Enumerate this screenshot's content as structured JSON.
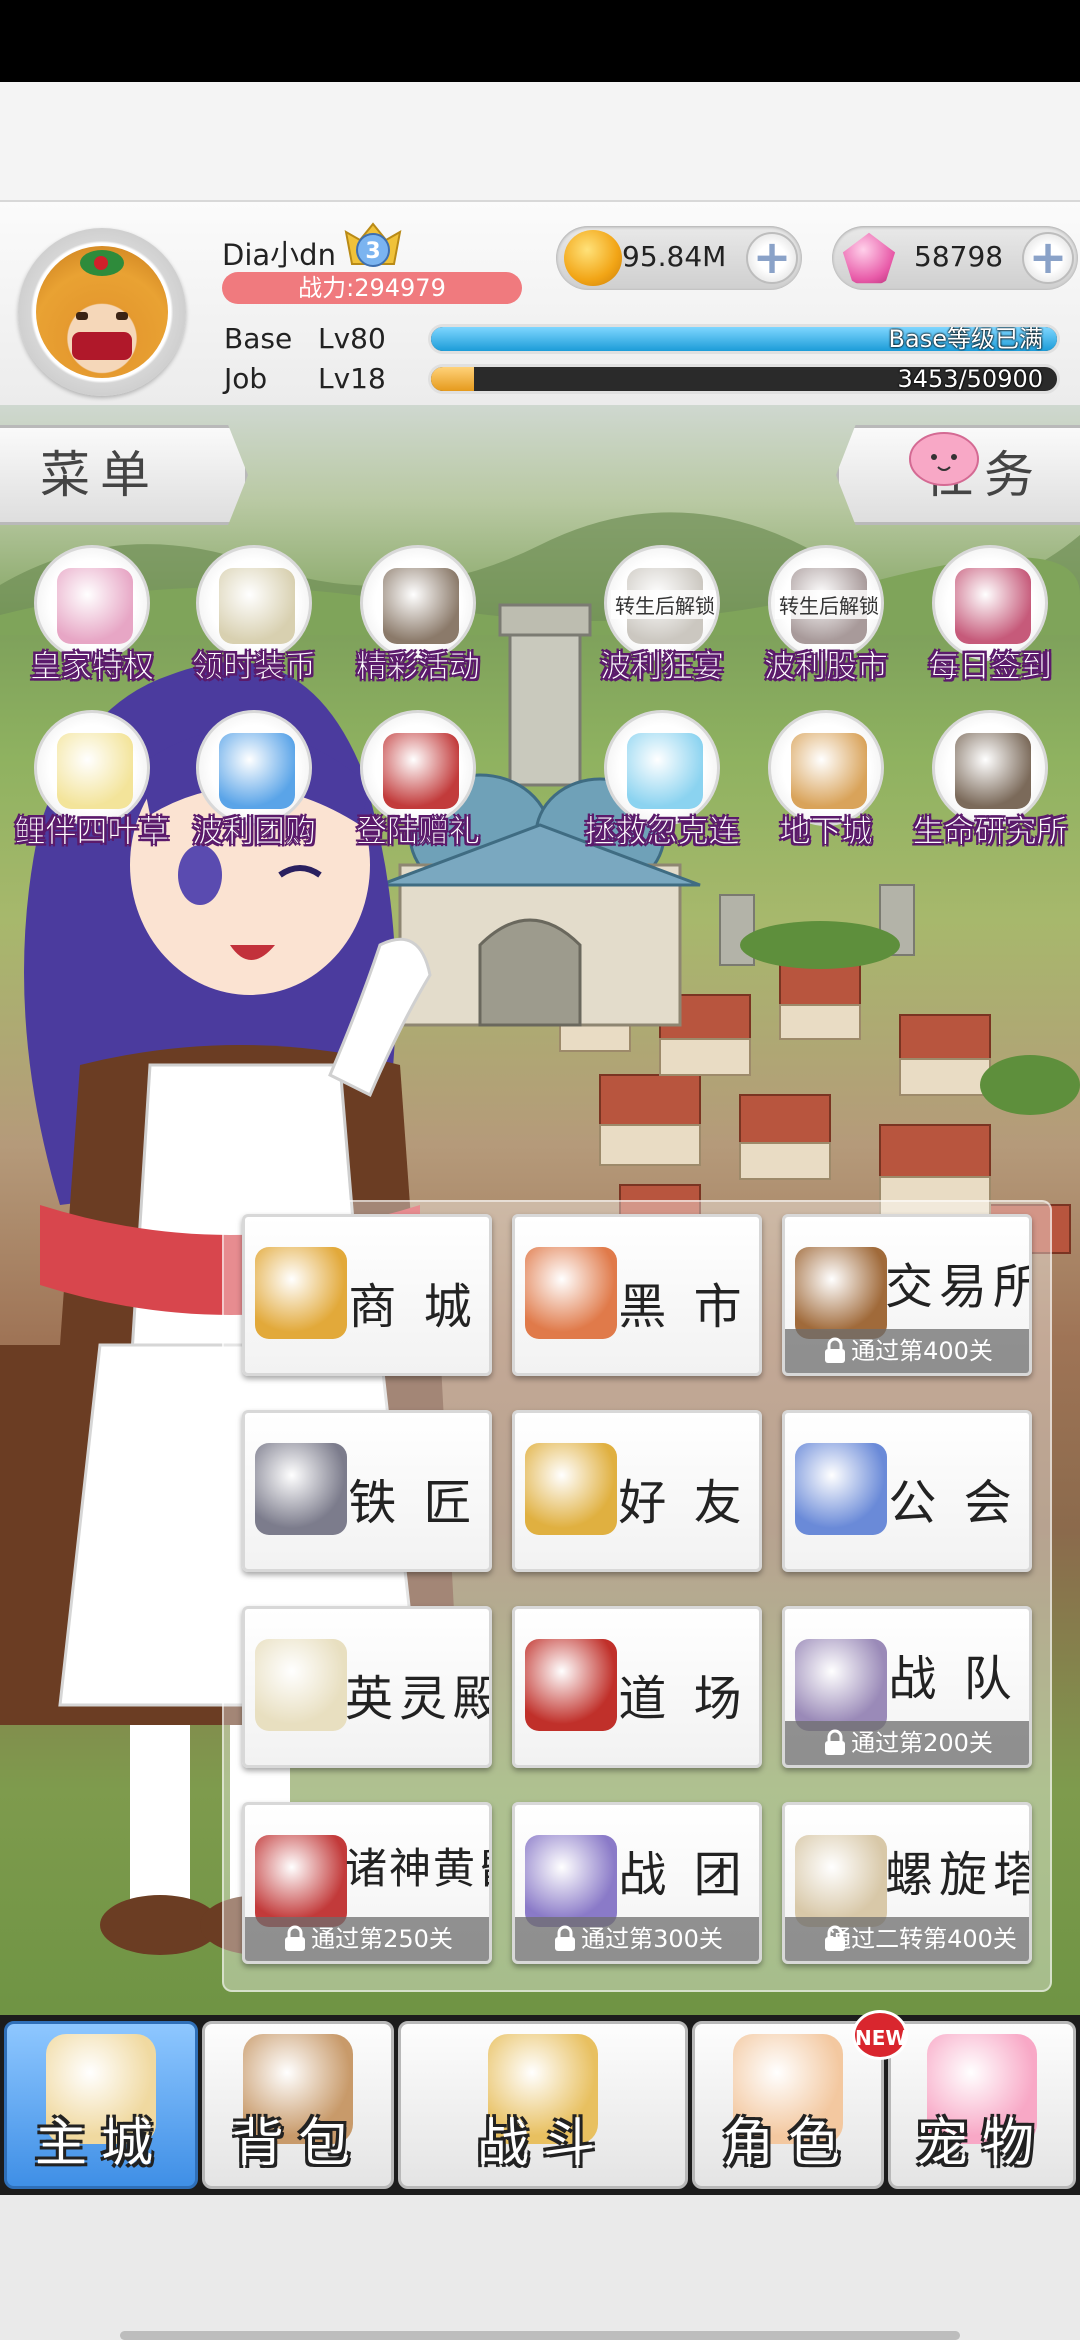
{
  "player": {
    "name": "Dia小dn",
    "rank_badge": "3",
    "combat_power": "战力:294979"
  },
  "currency": {
    "gold": "95.84M",
    "gems": "58798",
    "plus": "+"
  },
  "levels": {
    "base_label": "Base",
    "base_level": "Lv80",
    "base_bar_text": "Base等级已满",
    "base_progress": 1.0,
    "job_label": "Job",
    "job_level": "Lv18",
    "job_bar_text": "3453/50900",
    "job_progress": 0.068
  },
  "tabs": {
    "menu": "菜单",
    "tasks": "任务"
  },
  "features_row1": [
    {
      "label": "皇家特权",
      "icon": "royal-privilege-icon",
      "note": ""
    },
    {
      "label": "领时装币",
      "icon": "costume-coin-icon",
      "note": ""
    },
    {
      "label": "精彩活动",
      "icon": "events-icon",
      "note": ""
    },
    {
      "label": "波利狂宴",
      "icon": "poring-feast-icon",
      "note": "转生后解锁"
    },
    {
      "label": "波利股市",
      "icon": "poring-stock-icon",
      "note": "转生后解锁"
    },
    {
      "label": "每日签到",
      "icon": "daily-checkin-icon",
      "note": ""
    }
  ],
  "features_row2": [
    {
      "label": "鲤伴四叶草",
      "icon": "clover-icon",
      "note": ""
    },
    {
      "label": "波利团购",
      "icon": "group-buy-icon",
      "note": ""
    },
    {
      "label": "登陆赠礼",
      "icon": "login-gift-icon",
      "note": ""
    },
    {
      "label": "拯救忽克连",
      "icon": "rescue-icon",
      "note": ""
    },
    {
      "label": "地下城",
      "icon": "dungeon-icon",
      "note": ""
    },
    {
      "label": "生命研究所",
      "icon": "life-lab-icon",
      "note": ""
    }
  ],
  "grid": [
    {
      "name": "商 城",
      "icon": "treasure-chest-icon",
      "lock": ""
    },
    {
      "name": "黑 市",
      "icon": "money-bag-icon",
      "lock": ""
    },
    {
      "name": "交易所",
      "icon": "coin-sack-icon",
      "lock": "通过第400关"
    },
    {
      "name": "铁 匠",
      "icon": "anvil-icon",
      "lock": ""
    },
    {
      "name": "好 友",
      "icon": "friends-icon",
      "lock": ""
    },
    {
      "name": "公 会",
      "icon": "guild-shield-icon",
      "lock": ""
    },
    {
      "name": "英灵殿",
      "icon": "valhalla-icon",
      "lock": ""
    },
    {
      "name": "道 场",
      "icon": "dojo-devil-icon",
      "lock": ""
    },
    {
      "name": "战 队",
      "icon": "team-crest-icon",
      "lock": "通过第200关"
    },
    {
      "name": "诸神黄昏",
      "icon": "ragnarok-banner-icon",
      "lock": "通过第250关"
    },
    {
      "name": "战 团",
      "icon": "war-legion-icon",
      "lock": "通过第300关"
    },
    {
      "name": "螺旋塔",
      "icon": "spiral-tower-icon",
      "lock": "通过二转第400关"
    }
  ],
  "nav": [
    {
      "label": "主城",
      "icon": "main-city-icon",
      "active": true
    },
    {
      "label": "背包",
      "icon": "backpack-icon",
      "active": false
    },
    {
      "label": "战斗",
      "icon": "battle-icon",
      "active": false
    },
    {
      "label": "角色",
      "icon": "character-icon",
      "active": false
    },
    {
      "label": "宠物",
      "icon": "pet-icon",
      "active": false
    }
  ],
  "nav_new_badge": "NEW",
  "colors": {
    "base_bar": "#35b5ea",
    "job_bar": "#f2b33d",
    "power_bar": "#f07a7e",
    "feature_label_outline": "#5b1a6b",
    "nav_active": "#3f8fe6"
  }
}
